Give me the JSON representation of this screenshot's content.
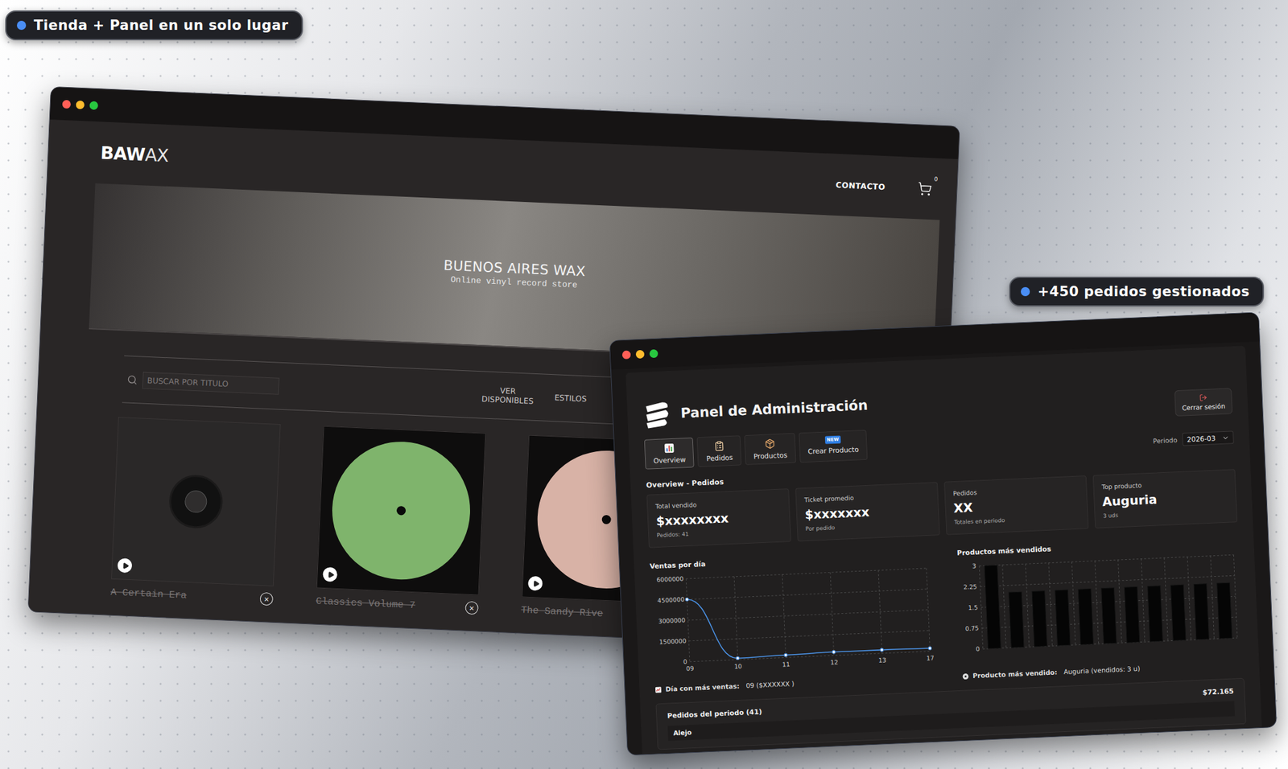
{
  "badges": [
    {
      "text": "Tienda + Panel en un solo lugar"
    },
    {
      "text": "+450 pedidos gestionados"
    }
  ],
  "store": {
    "logo": {
      "bold": "BAW",
      "light": "AX"
    },
    "nav": [
      {
        "label": "CONTACTO"
      }
    ],
    "cart": {
      "count": "0"
    },
    "hero": {
      "title": "BUENOS AIRES WAX",
      "subtitle": "Online vinyl record store"
    },
    "search": {
      "placeholder": "BUSCAR POR TITULO"
    },
    "filters": [
      {
        "label": "VER DISPONIBLES"
      },
      {
        "label": "ESTILOS"
      }
    ],
    "products": [
      {
        "title": "A Certain Era",
        "sold_out": true,
        "kind": "record",
        "color": "#2f2d2d",
        "remove": "×"
      },
      {
        "title": "Classics Volume 7",
        "sold_out": true,
        "kind": "label",
        "color": "#7fb46c",
        "remove": "×"
      },
      {
        "title": "The Sandy Rive",
        "sold_out": true,
        "kind": "label",
        "color": "#d8b2a6"
      }
    ]
  },
  "admin": {
    "title": "Panel de Administración",
    "logout": "Cerrar sesión",
    "tabs": [
      {
        "label": "Overview",
        "selected": true
      },
      {
        "label": "Pedidos",
        "selected": false
      },
      {
        "label": "Productos",
        "selected": false
      },
      {
        "label": "Crear Producto",
        "selected": false,
        "badge": "NEW"
      }
    ],
    "period": {
      "label": "Periodo",
      "value": "2026-03"
    },
    "section": "Overview - Pedidos",
    "stats": [
      {
        "label": "Total vendido",
        "value": "$xxxxxxxx",
        "sub": "Pedidos: 41"
      },
      {
        "label": "Ticket promedio",
        "value": "$xxxxxxx",
        "sub": "Por pedido"
      },
      {
        "label": "Pedidos",
        "value": "XX",
        "sub": "Totales en periodo"
      },
      {
        "label": "Top producto",
        "value": "Auguria",
        "sub": "3 uds"
      }
    ],
    "sales_chart": {
      "title": "Ventas por día",
      "y_ticks": [
        "6000000",
        "4500000",
        "3000000",
        "1500000",
        "0"
      ],
      "x_labels": [
        "09",
        "10",
        "11",
        "12",
        "13",
        "17"
      ],
      "values": [
        4500000,
        100000,
        180000,
        250000,
        250000,
        220000
      ],
      "note_label": "Día con más ventas:",
      "note_value": "09 ($XXXXXX )"
    },
    "products_chart": {
      "title": "Productos más vendidos",
      "y_ticks": [
        "3",
        "2.25",
        "1.5",
        "0.75",
        "0"
      ],
      "values": [
        3,
        2,
        2,
        2,
        2,
        2,
        2,
        2,
        2,
        2,
        2
      ],
      "note_label": "Producto más vendido:",
      "note_value": "Auguria (vendidos: 3 u)"
    },
    "orders": {
      "title": "Pedidos del periodo (41)",
      "total": "$72.165",
      "rows": [
        {
          "name": "Alejo"
        }
      ]
    }
  }
}
